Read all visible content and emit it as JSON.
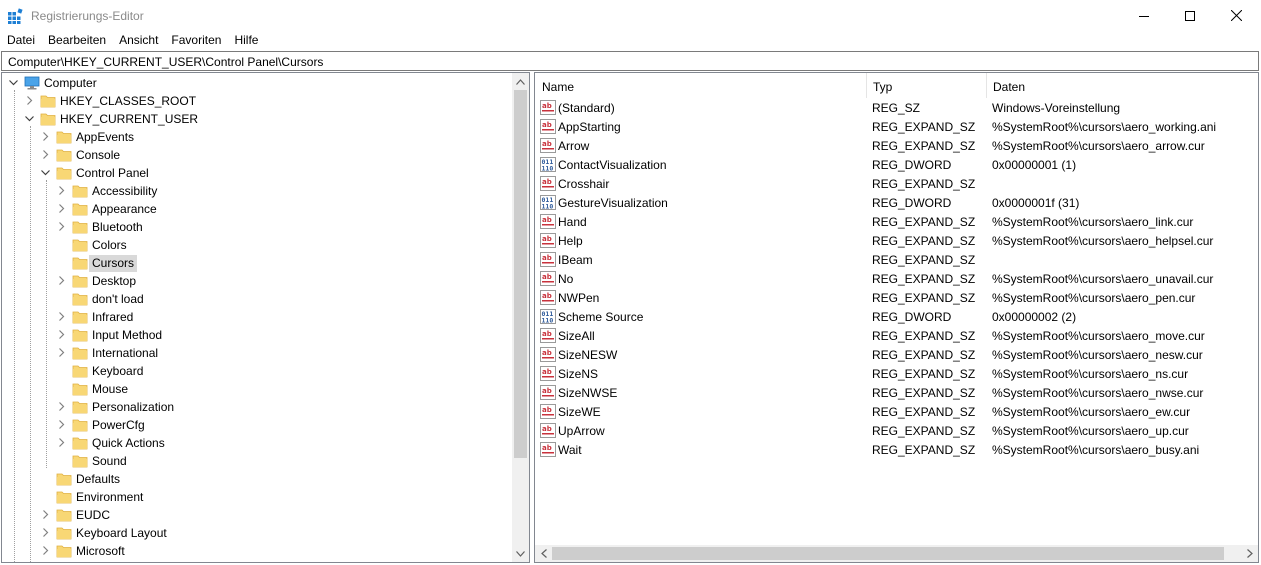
{
  "window": {
    "title": "Registrierungs-Editor",
    "icon": "registry-editor-icon"
  },
  "menu": [
    "Datei",
    "Bearbeiten",
    "Ansicht",
    "Favoriten",
    "Hilfe"
  ],
  "address": "Computer\\HKEY_CURRENT_USER\\Control Panel\\Cursors",
  "tree": {
    "root": "Computer",
    "items": [
      {
        "label": "HKEY_CLASSES_ROOT",
        "level": 1,
        "expander": "collapsed"
      },
      {
        "label": "HKEY_CURRENT_USER",
        "level": 1,
        "expander": "expanded"
      },
      {
        "label": "AppEvents",
        "level": 2,
        "expander": "collapsed"
      },
      {
        "label": "Console",
        "level": 2,
        "expander": "collapsed"
      },
      {
        "label": "Control Panel",
        "level": 2,
        "expander": "expanded"
      },
      {
        "label": "Accessibility",
        "level": 3,
        "expander": "collapsed"
      },
      {
        "label": "Appearance",
        "level": 3,
        "expander": "collapsed"
      },
      {
        "label": "Bluetooth",
        "level": 3,
        "expander": "collapsed"
      },
      {
        "label": "Colors",
        "level": 3,
        "expander": "none"
      },
      {
        "label": "Cursors",
        "level": 3,
        "expander": "none",
        "selected": true
      },
      {
        "label": "Desktop",
        "level": 3,
        "expander": "collapsed"
      },
      {
        "label": "don't load",
        "level": 3,
        "expander": "none"
      },
      {
        "label": "Infrared",
        "level": 3,
        "expander": "collapsed"
      },
      {
        "label": "Input Method",
        "level": 3,
        "expander": "collapsed"
      },
      {
        "label": "International",
        "level": 3,
        "expander": "collapsed"
      },
      {
        "label": "Keyboard",
        "level": 3,
        "expander": "none"
      },
      {
        "label": "Mouse",
        "level": 3,
        "expander": "none"
      },
      {
        "label": "Personalization",
        "level": 3,
        "expander": "collapsed"
      },
      {
        "label": "PowerCfg",
        "level": 3,
        "expander": "collapsed"
      },
      {
        "label": "Quick Actions",
        "level": 3,
        "expander": "collapsed"
      },
      {
        "label": "Sound",
        "level": 3,
        "expander": "none"
      },
      {
        "label": "Defaults",
        "level": 2,
        "expander": "none"
      },
      {
        "label": "Environment",
        "level": 2,
        "expander": "none"
      },
      {
        "label": "EUDC",
        "level": 2,
        "expander": "collapsed"
      },
      {
        "label": "Keyboard Layout",
        "level": 2,
        "expander": "collapsed"
      },
      {
        "label": "Microsoft",
        "level": 2,
        "expander": "collapsed"
      }
    ]
  },
  "columns": {
    "name": "Name",
    "type": "Typ",
    "data": "Daten"
  },
  "values": [
    {
      "name": "(Standard)",
      "type": "REG_SZ",
      "data": "Windows-Voreinstellung",
      "icon": "string-value-icon"
    },
    {
      "name": "AppStarting",
      "type": "REG_EXPAND_SZ",
      "data": "%SystemRoot%\\cursors\\aero_working.ani",
      "icon": "string-value-icon"
    },
    {
      "name": "Arrow",
      "type": "REG_EXPAND_SZ",
      "data": "%SystemRoot%\\cursors\\aero_arrow.cur",
      "icon": "string-value-icon"
    },
    {
      "name": "ContactVisualization",
      "type": "REG_DWORD",
      "data": "0x00000001 (1)",
      "icon": "binary-value-icon"
    },
    {
      "name": "Crosshair",
      "type": "REG_EXPAND_SZ",
      "data": "",
      "icon": "string-value-icon"
    },
    {
      "name": "GestureVisualization",
      "type": "REG_DWORD",
      "data": "0x0000001f (31)",
      "icon": "binary-value-icon"
    },
    {
      "name": "Hand",
      "type": "REG_EXPAND_SZ",
      "data": "%SystemRoot%\\cursors\\aero_link.cur",
      "icon": "string-value-icon"
    },
    {
      "name": "Help",
      "type": "REG_EXPAND_SZ",
      "data": "%SystemRoot%\\cursors\\aero_helpsel.cur",
      "icon": "string-value-icon"
    },
    {
      "name": "IBeam",
      "type": "REG_EXPAND_SZ",
      "data": "",
      "icon": "string-value-icon"
    },
    {
      "name": "No",
      "type": "REG_EXPAND_SZ",
      "data": "%SystemRoot%\\cursors\\aero_unavail.cur",
      "icon": "string-value-icon"
    },
    {
      "name": "NWPen",
      "type": "REG_EXPAND_SZ",
      "data": "%SystemRoot%\\cursors\\aero_pen.cur",
      "icon": "string-value-icon"
    },
    {
      "name": "Scheme Source",
      "type": "REG_DWORD",
      "data": "0x00000002 (2)",
      "icon": "binary-value-icon"
    },
    {
      "name": "SizeAll",
      "type": "REG_EXPAND_SZ",
      "data": "%SystemRoot%\\cursors\\aero_move.cur",
      "icon": "string-value-icon"
    },
    {
      "name": "SizeNESW",
      "type": "REG_EXPAND_SZ",
      "data": "%SystemRoot%\\cursors\\aero_nesw.cur",
      "icon": "string-value-icon"
    },
    {
      "name": "SizeNS",
      "type": "REG_EXPAND_SZ",
      "data": "%SystemRoot%\\cursors\\aero_ns.cur",
      "icon": "string-value-icon"
    },
    {
      "name": "SizeNWSE",
      "type": "REG_EXPAND_SZ",
      "data": "%SystemRoot%\\cursors\\aero_nwse.cur",
      "icon": "string-value-icon"
    },
    {
      "name": "SizeWE",
      "type": "REG_EXPAND_SZ",
      "data": "%SystemRoot%\\cursors\\aero_ew.cur",
      "icon": "string-value-icon"
    },
    {
      "name": "UpArrow",
      "type": "REG_EXPAND_SZ",
      "data": "%SystemRoot%\\cursors\\aero_up.cur",
      "icon": "string-value-icon"
    },
    {
      "name": "Wait",
      "type": "REG_EXPAND_SZ",
      "data": "%SystemRoot%\\cursors\\aero_busy.ani",
      "icon": "string-value-icon"
    }
  ],
  "colors": {
    "folder": "#f8d775",
    "folder_dark": "#e0b040",
    "selection": "#d9d9d9",
    "string_icon": "#c8323c",
    "binary_icon": "#2e5a9a",
    "registry_icon": "#1e7fd4"
  }
}
